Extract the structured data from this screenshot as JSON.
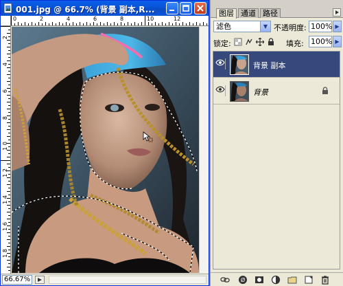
{
  "document": {
    "title": "001.jpg @ 66.7% (背景 副本,R...",
    "zoom": "66.67%",
    "ruler_top_labels": [
      "0",
      "2",
      "4",
      "6",
      "8",
      "10",
      "12"
    ],
    "ruler_left_labels": [
      "2",
      "4",
      "6",
      "8",
      "1\n0",
      "1\n2",
      "1\n4",
      "1\n6",
      "1\n8"
    ]
  },
  "panel": {
    "tabs": [
      {
        "label": "图层",
        "active": true
      },
      {
        "label": "通道",
        "active": false
      },
      {
        "label": "路径",
        "active": false
      }
    ],
    "blend_mode": "滤色",
    "opacity_label": "不透明度:",
    "opacity_value": "100%",
    "lock_label": "锁定:",
    "fill_label": "填充:",
    "fill_value": "100%",
    "layers": [
      {
        "name": "背景 副本",
        "selected": true,
        "visible": true,
        "locked": false,
        "italic": false
      },
      {
        "name": "背景",
        "selected": false,
        "visible": true,
        "locked": true,
        "italic": true
      }
    ],
    "bottom_icons": [
      "link-icon",
      "fx-icon",
      "mask-icon",
      "adjustment-icon",
      "folder-icon",
      "new-layer-icon",
      "trash-icon"
    ]
  },
  "colors": {
    "title_bar": "#0754d8",
    "selected_layer": "#36487c",
    "panel_bg": "#ece9d8"
  }
}
